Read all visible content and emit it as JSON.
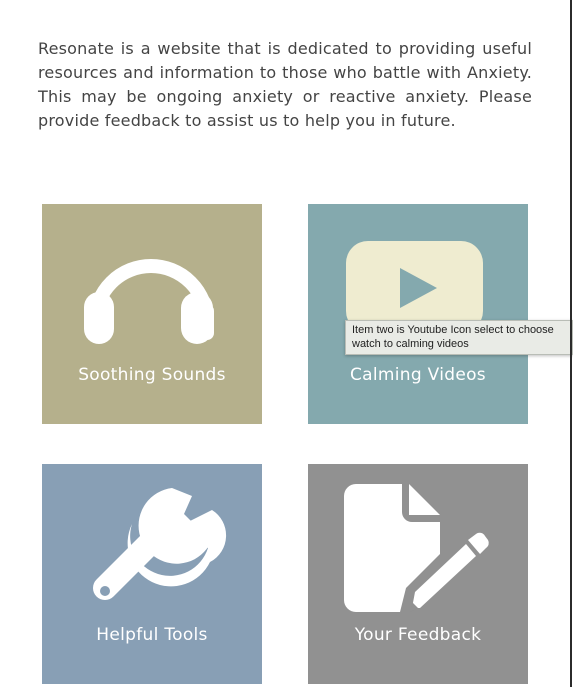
{
  "intro": {
    "text": "Resonate is a website that is dedicated to providing useful resources and information to those who battle with Anxiety. This may be ongoing anxiety or reactive anxiety. Please provide feedback to assist us to help you in future."
  },
  "tiles": [
    {
      "label": "Soothing Sounds",
      "icon": "headphones-icon",
      "color": "#b5b08c",
      "icon_color": "#ffffff"
    },
    {
      "label": "Calming Videos",
      "icon": "youtube-play-icon",
      "color": "#84a9ae",
      "icon_color": "#efecd0"
    },
    {
      "label": "Helpful Tools",
      "icon": "wrench-icon",
      "color": "#889fb5",
      "icon_color": "#ffffff"
    },
    {
      "label": "Your Feedback",
      "icon": "document-edit-icon",
      "color": "#919191",
      "icon_color": "#ffffff"
    }
  ],
  "tooltip": {
    "text": "Item two is Youtube Icon select to choose\nwatch to calming videos"
  }
}
